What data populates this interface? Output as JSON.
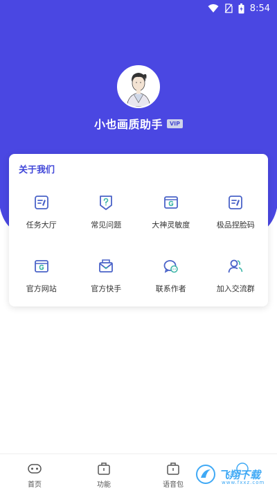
{
  "colors": {
    "header": "#4a47e2",
    "accent": "#4046d8",
    "icon": "#4a63c8"
  },
  "status_bar": {
    "time": "8:54",
    "icons": [
      "wifi-icon",
      "no-sim-icon",
      "battery-icon"
    ]
  },
  "profile": {
    "name": "小也画质助手",
    "badge": "VIP"
  },
  "about": {
    "title": "关于我们",
    "items": [
      {
        "label": "任务大厅",
        "icon": "checklist-icon"
      },
      {
        "label": "常见问题",
        "icon": "question-shield-icon"
      },
      {
        "label": "大神灵敏度",
        "icon": "g-window-icon"
      },
      {
        "label": "极品捏脸码",
        "icon": "checklist-icon"
      },
      {
        "label": "官方网站",
        "icon": "g-browser-icon"
      },
      {
        "label": "官方快手",
        "icon": "envelope-icon"
      },
      {
        "label": "联系作者",
        "icon": "chat-icon"
      },
      {
        "label": "加入交流群",
        "icon": "group-icon"
      }
    ]
  },
  "bottom_nav": [
    {
      "label": "首页",
      "icon": "gamepad-icon"
    },
    {
      "label": "功能",
      "icon": "toolbox-icon"
    },
    {
      "label": "语音包",
      "icon": "toolbox-icon"
    },
    {
      "label": "",
      "icon": "more-icon"
    }
  ],
  "watermark": {
    "text": "飞翔下载",
    "sub": "www.fxxz.com"
  }
}
